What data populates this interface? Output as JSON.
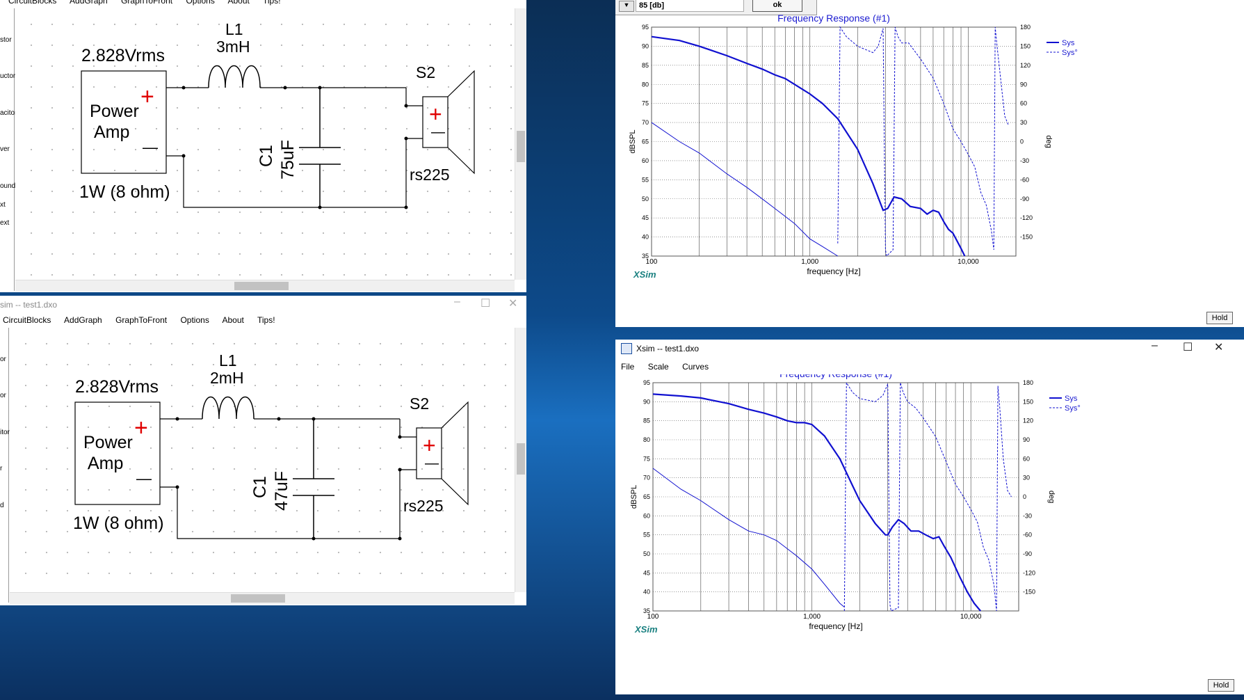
{
  "schematic_menu": {
    "items": [
      "CircuitBlocks",
      "AddGraph",
      "GraphToFront",
      "Options",
      "About",
      "Tips!"
    ]
  },
  "palette_items": [
    "stor",
    "uctor",
    "acitor",
    "ver",
    "ound",
    "xt",
    "ext"
  ],
  "palette_items_bottom": [
    "or",
    "or",
    "itor",
    "r",
    "d"
  ],
  "bottom_schematic_title": "sim -- test1.dxo",
  "top_schematic": {
    "source": "2.828Vrms",
    "amp_line1": "Power",
    "amp_line2": "Amp",
    "amp_rating": "1W (8 ohm)",
    "plus": "+",
    "minus": "—",
    "inductor_name": "L1",
    "inductor_value": "3mH",
    "cap_name": "C1",
    "cap_value": "75uF",
    "speaker_name": "S2",
    "speaker_model": "rs225"
  },
  "bottom_schematic": {
    "source": "2.828Vrms",
    "amp_line1": "Power",
    "amp_line2": "Amp",
    "amp_rating": "1W (8 ohm)",
    "plus": "+",
    "minus": "—",
    "inductor_name": "L1",
    "inductor_value": "2mH",
    "cap_name": "C1",
    "cap_value": "47uF",
    "speaker_name": "S2",
    "speaker_model": "rs225"
  },
  "top_dialog": {
    "field_value": "85 [db]",
    "ok_label": "ok"
  },
  "bottom_graph_window": {
    "title": "Xsim -- test1.dxo",
    "menu": [
      "File",
      "Scale",
      "Curves"
    ]
  },
  "graph_common": {
    "title": "Frequency Response (#1)",
    "xlabel": "frequency [Hz]",
    "ylabel_left": "dBSPL",
    "ylabel_right": "deg",
    "brand": "XSim",
    "hold_label": "Hold",
    "legend": [
      "Sys",
      "Sys°"
    ],
    "x_ticks": [
      "100",
      "1,000",
      "10,000"
    ],
    "y_ticks_left": [
      "95",
      "90",
      "85",
      "80",
      "75",
      "70",
      "65",
      "60",
      "55",
      "50",
      "45",
      "40",
      "35"
    ],
    "y_ticks_right": [
      "180",
      "150",
      "120",
      "90",
      "60",
      "30",
      "0",
      "-30",
      "-60",
      "-90",
      "-120",
      "-150"
    ]
  },
  "chart_data": [
    {
      "type": "line",
      "title": "Frequency Response (#1)",
      "xlabel": "frequency [Hz]",
      "ylabel": "dBSPL",
      "ylabel_right": "deg",
      "x_scale": "log",
      "xlim": [
        100,
        20000
      ],
      "ylim": [
        35,
        95
      ],
      "ylim_right": [
        -180,
        180
      ],
      "grid": true,
      "legend_position": "top-right",
      "series": [
        {
          "name": "Sys",
          "style": "solid-thick",
          "axis": "left",
          "x": [
            100,
            150,
            200,
            300,
            400,
            500,
            600,
            700,
            800,
            1000,
            1200,
            1500,
            2000,
            2500,
            2900,
            3100,
            3400,
            3800,
            4300,
            5000,
            5500,
            6000,
            6500,
            7000,
            7500,
            8000,
            9000,
            9500
          ],
          "y": [
            92.5,
            91.5,
            90,
            87.5,
            85.5,
            84,
            82.5,
            81.5,
            80,
            77.5,
            75,
            71,
            63,
            54,
            47,
            47.5,
            50.5,
            50,
            48,
            47.5,
            46,
            47,
            46.5,
            44,
            42,
            41,
            37,
            35
          ]
        },
        {
          "name": "",
          "style": "solid-thin",
          "axis": "left",
          "x": [
            100,
            150,
            200,
            300,
            400,
            500,
            600,
            800,
            1000,
            1200,
            1500
          ],
          "y": [
            70,
            65,
            62,
            56.5,
            53,
            50,
            47.5,
            43.5,
            39.5,
            37.5,
            35
          ]
        },
        {
          "name": "Sys°",
          "style": "dashed",
          "axis": "right",
          "x": [
            1500,
            1550,
            1700,
            2000,
            2500,
            2700,
            2900,
            2950,
            3000,
            3050,
            3350,
            3450,
            3600,
            3800,
            4200,
            5000,
            6000,
            7000,
            8000,
            9000,
            10000,
            11000,
            12000,
            13000,
            14000,
            14500,
            14800,
            15200,
            16000,
            17000,
            18000
          ],
          "y": [
            -160,
            180,
            165,
            150,
            140,
            150,
            178,
            0,
            -170,
            -180,
            -170,
            180,
            165,
            155,
            155,
            130,
            100,
            60,
            20,
            0,
            -20,
            -40,
            -80,
            -100,
            -140,
            -170,
            180,
            150,
            100,
            40,
            25
          ]
        }
      ]
    },
    {
      "type": "line",
      "title": "Frequency Response (#1)",
      "xlabel": "frequency [Hz]",
      "ylabel": "dBSPL",
      "ylabel_right": "deg",
      "x_scale": "log",
      "xlim": [
        100,
        20000
      ],
      "ylim": [
        35,
        95
      ],
      "ylim_right": [
        -180,
        180
      ],
      "grid": true,
      "legend_position": "top-right",
      "series": [
        {
          "name": "Sys",
          "style": "solid-thick",
          "axis": "left",
          "x": [
            100,
            150,
            200,
            300,
            400,
            500,
            600,
            700,
            800,
            900,
            1000,
            1200,
            1500,
            1800,
            2000,
            2500,
            2900,
            3000,
            3200,
            3500,
            3800,
            4200,
            4700,
            5200,
            5800,
            6300,
            6800,
            7500,
            8500,
            9500,
            10500,
            11500
          ],
          "y": [
            92,
            91.5,
            91,
            89.5,
            88,
            87,
            86,
            85,
            84.5,
            84.5,
            84,
            81,
            75,
            68,
            64,
            58,
            55,
            55,
            57,
            59,
            58,
            56,
            56,
            55,
            54,
            54.5,
            52,
            49,
            44,
            40,
            37,
            35
          ]
        },
        {
          "name": "",
          "style": "solid-thin",
          "axis": "left",
          "x": [
            100,
            150,
            200,
            300,
            400,
            500,
            600,
            800,
            1000,
            1200,
            1500,
            1600
          ],
          "y": [
            72.5,
            67,
            64,
            59,
            56,
            55,
            53.5,
            49.5,
            46,
            42,
            37,
            36
          ]
        },
        {
          "name": "Sys°",
          "style": "dashed",
          "axis": "right",
          "x": [
            1600,
            1650,
            1800,
            2000,
            2500,
            2800,
            3000,
            3050,
            3100,
            3150,
            3500,
            3600,
            3750,
            4000,
            4500,
            5000,
            6000,
            7000,
            8000,
            9000,
            10000,
            11000,
            12000,
            13000,
            14000,
            14500,
            14800,
            15200,
            16000,
            17000,
            18000
          ],
          "y": [
            -180,
            180,
            165,
            155,
            150,
            160,
            178,
            0,
            -170,
            -180,
            -175,
            180,
            165,
            150,
            140,
            125,
            95,
            55,
            20,
            0,
            -20,
            -40,
            -80,
            -100,
            -140,
            -180,
            175,
            140,
            60,
            10,
            0
          ]
        }
      ]
    }
  ]
}
